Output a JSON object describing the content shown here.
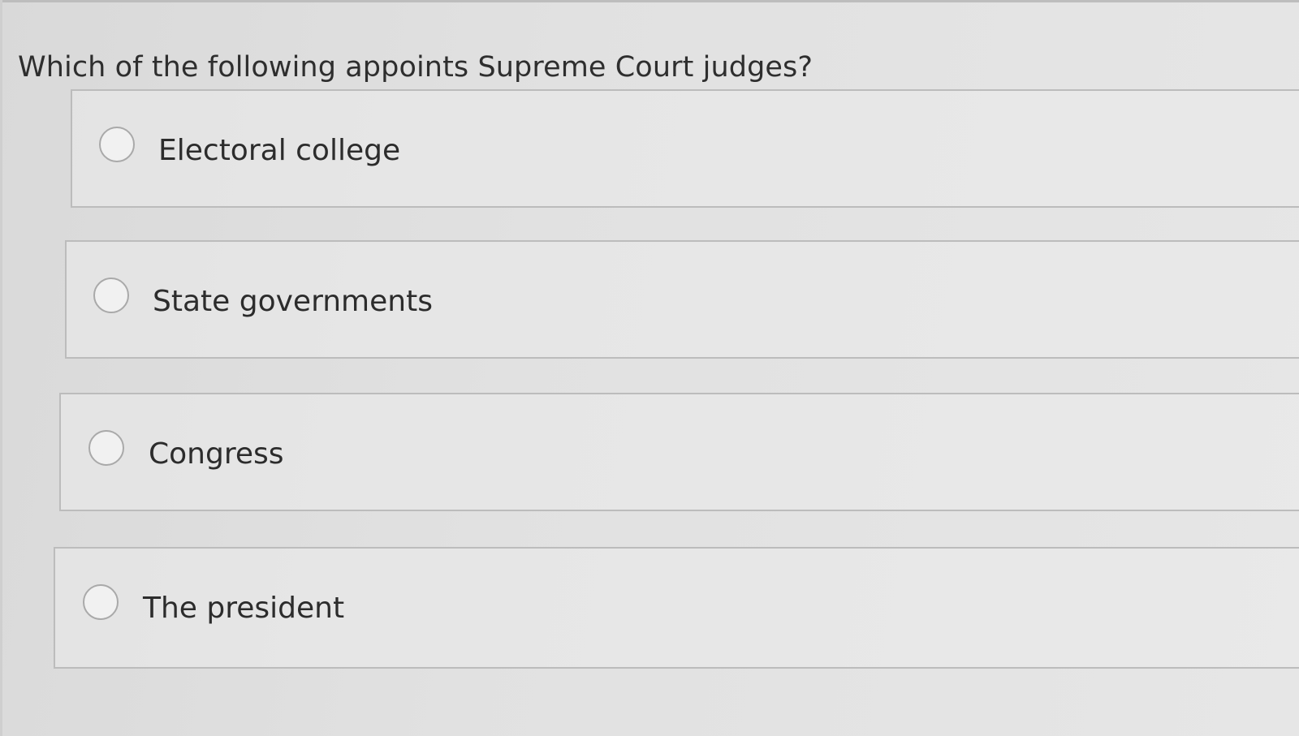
{
  "question": {
    "text": "Which of the following appoints Supreme Court judges?"
  },
  "options": [
    {
      "label": "Electoral college",
      "selected": false
    },
    {
      "label": "State governments",
      "selected": false
    },
    {
      "label": "Congress",
      "selected": false
    },
    {
      "label": "The president",
      "selected": false
    }
  ],
  "colors": {
    "background": "#e0e0e0",
    "border": "#bcbcbc",
    "text": "#2e2e2e",
    "radio_border": "#a9a9a9"
  }
}
